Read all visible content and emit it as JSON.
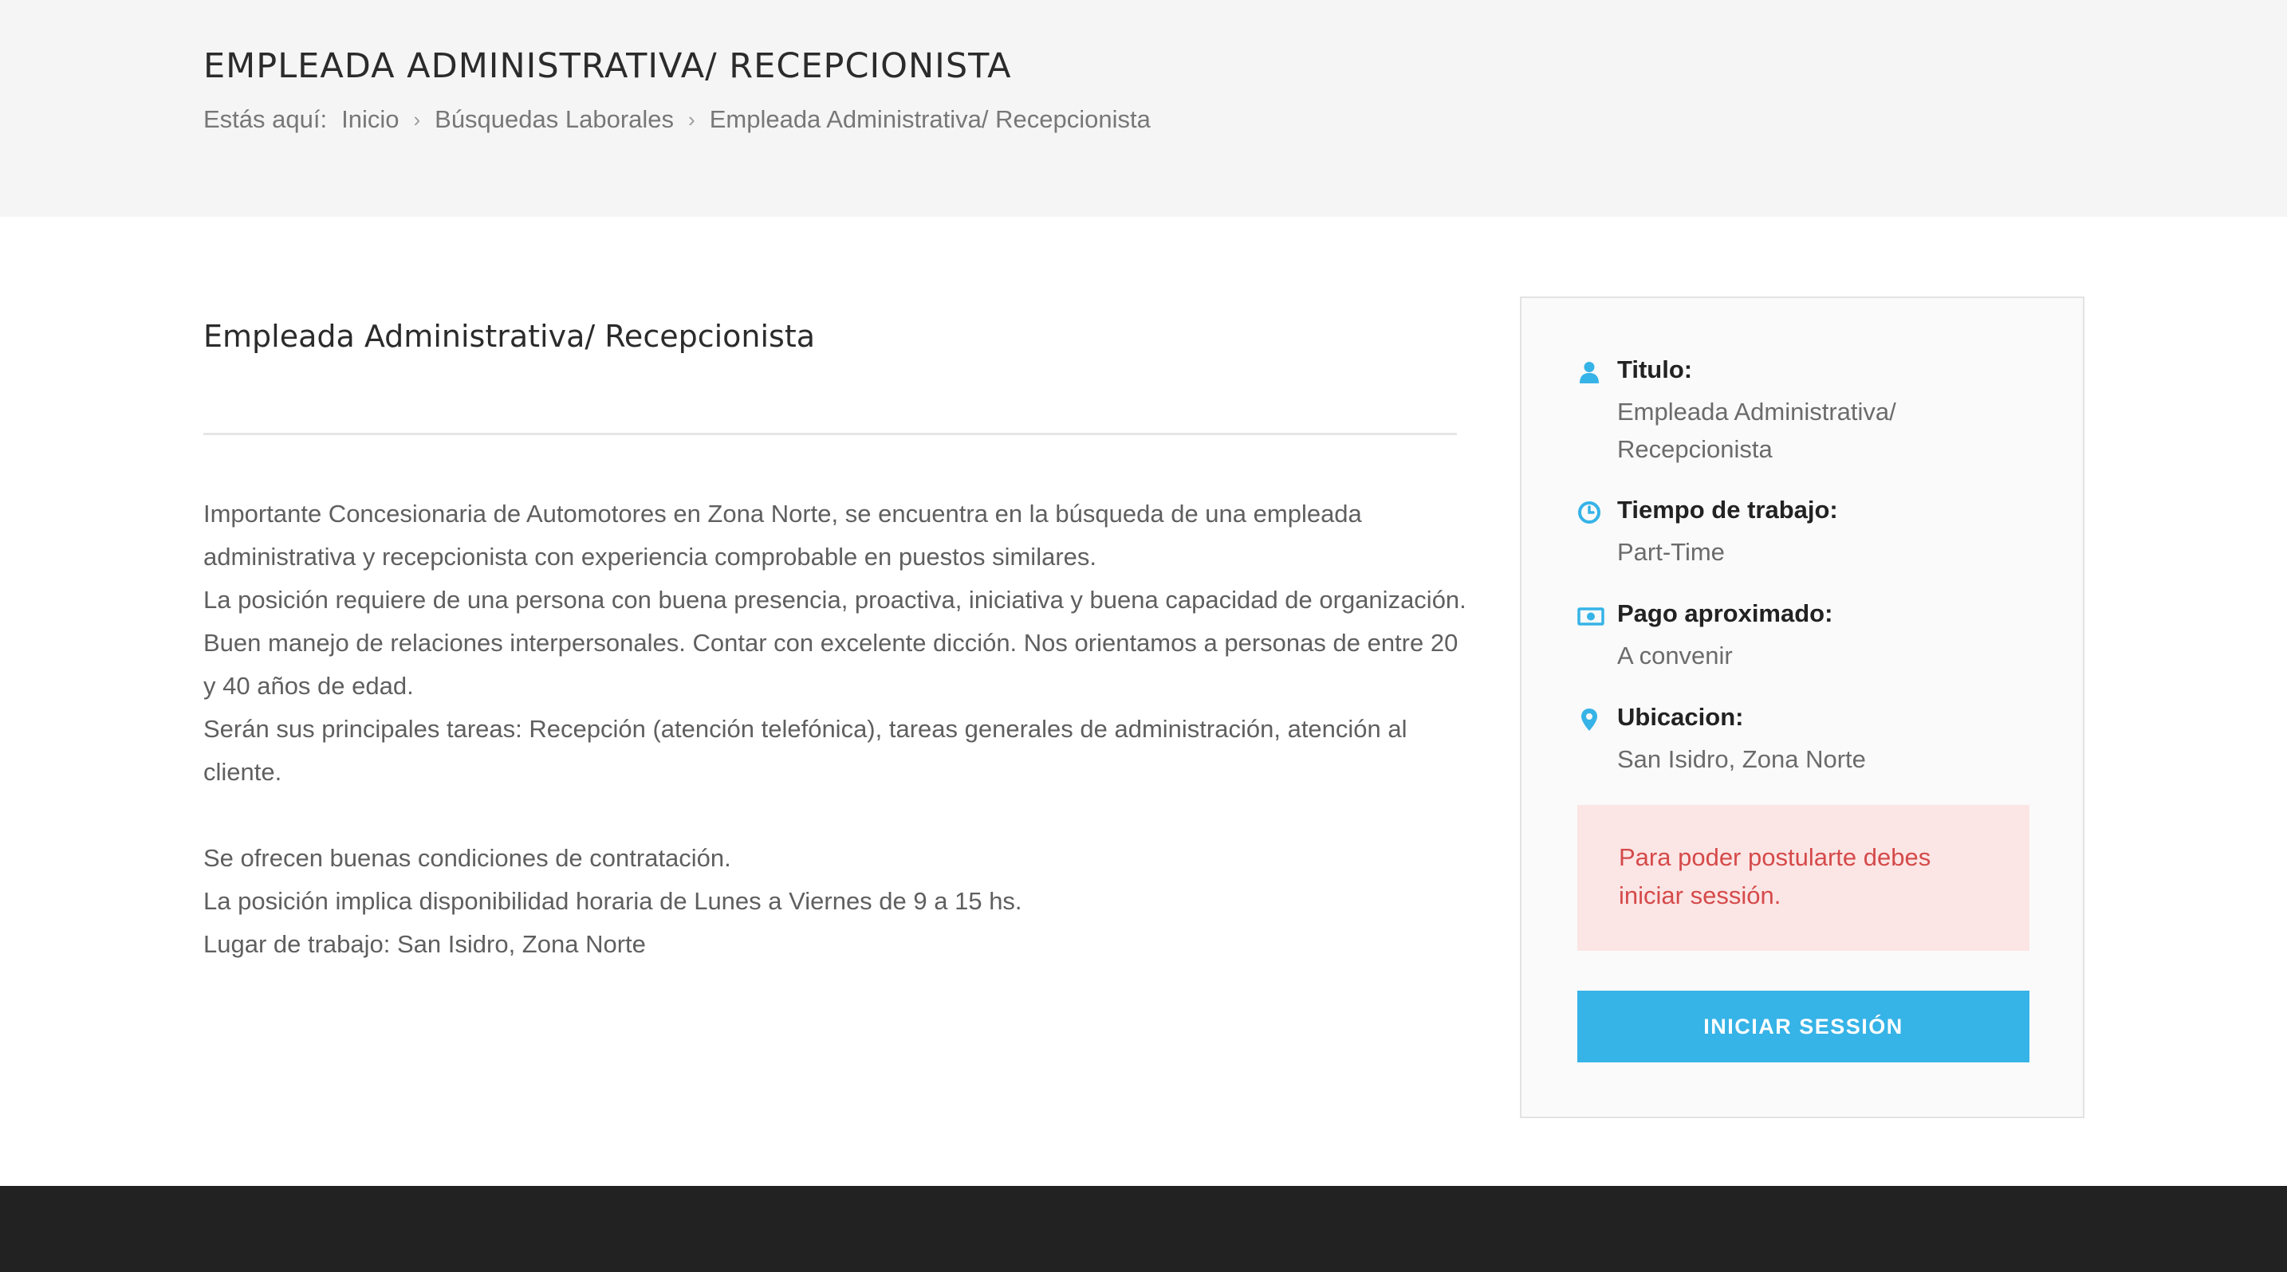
{
  "header": {
    "title": "EMPLEADA ADMINISTRATIVA/ RECEPCIONISTA",
    "breadcrumb": {
      "prefix": "Estás aquí:",
      "items": [
        "Inicio",
        "Búsquedas Laborales",
        "Empleada Administrativa/ Recepcionista"
      ],
      "separator": "›"
    }
  },
  "main": {
    "job_title": "Empleada Administrativa/ Recepcionista",
    "description": [
      "Importante Concesionaria de Automotores en Zona Norte, se encuentra en la búsqueda de una empleada",
      "administrativa y recepcionista con experiencia comprobable en puestos similares.",
      "La posición requiere de una persona con buena presencia, proactiva, iniciativa y buena capacidad de organización.",
      "Buen manejo de relaciones interpersonales. Contar con excelente dicción. Nos orientamos a personas de entre 20",
      "y 40 años de edad.",
      "Serán sus principales tareas: Recepción (atención telefónica), tareas generales de administración, atención al",
      "cliente.",
      "",
      "Se ofrecen buenas condiciones de contratación.",
      "La posición implica disponibilidad horaria de Lunes a Viernes de 9 a 15 hs.",
      "Lugar de trabajo: San Isidro, Zona Norte"
    ]
  },
  "sidebar": {
    "items": [
      {
        "icon": "user-icon",
        "label": "Titulo:",
        "value": "Empleada Administrativa/ Recepcionista"
      },
      {
        "icon": "clock-icon",
        "label": "Tiempo de trabajo:",
        "value": "Part-Time"
      },
      {
        "icon": "money-icon",
        "label": "Pago aproximado:",
        "value": "A convenir"
      },
      {
        "icon": "map-marker-icon",
        "label": "Ubicacion:",
        "value": "San Isidro, Zona Norte"
      }
    ],
    "alert": "Para poder postularte debes iniciar sessión.",
    "login_button": "INICIAR SESSIÓN"
  },
  "colors": {
    "accent": "#36b3e7",
    "alert_bg": "#fce5e5",
    "alert_text": "#d54a4a",
    "footer": "#222222",
    "header_bg": "#f5f5f5"
  }
}
